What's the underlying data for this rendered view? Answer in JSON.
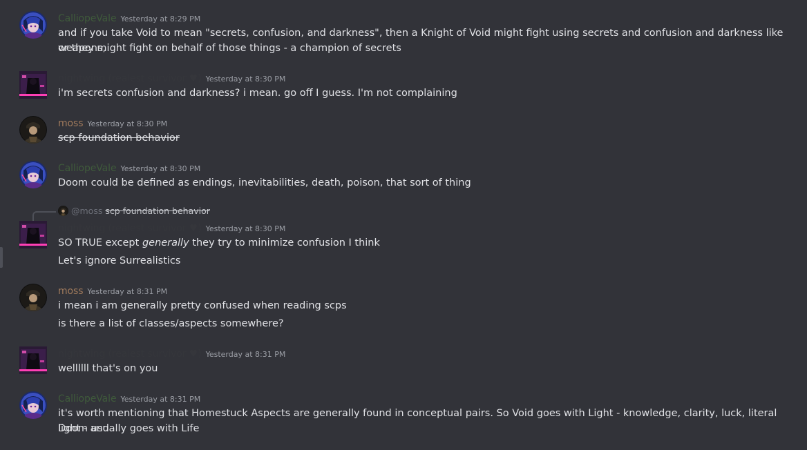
{
  "messages": [
    {
      "author": "CalliopeVale",
      "author_color": "#3f5a3b",
      "avatar": "calliope-avatar",
      "time": "Yesterday at 8:29 PM",
      "lines": [
        "and if you take Void to mean \"secrets, confusion, and darkness\", then a Knight of Void might fight using secrets and confusion and darkness like weapons,",
        "or they might fight on behalf of those things - a champion of secrets"
      ]
    },
    {
      "author": "nightwing (realest survivor ♥)",
      "author_color": "#35363b",
      "avatar": "nightwing-avatar",
      "time": "Yesterday at 8:30 PM",
      "lines": [
        "i'm secrets confusion and darkness? i mean. go off I guess. I'm not complaining"
      ]
    },
    {
      "author": "moss",
      "author_color": "#a07a5c",
      "avatar": "moss-avatar",
      "time": "Yesterday at 8:30 PM",
      "lines": [
        "scp foundation behavior"
      ]
    },
    {
      "author": "CalliopeVale",
      "author_color": "#3f5a3b",
      "avatar": "calliope-avatar",
      "time": "Yesterday at 8:30 PM",
      "lines": [
        "Doom could be defined as endings, inevitabilities, death, poison, that sort of thing"
      ]
    },
    {
      "reply": {
        "mention": "@moss",
        "text": "scp foundation behavior"
      },
      "author": "nightwing (realest survivor ♥)",
      "author_color": "#35363b",
      "avatar": "nightwing-avatar",
      "time": "Yesterday at 8:30 PM",
      "line1_pre": "SO TRUE except ",
      "line1_em": "generally",
      "line1_post": " they try to minimize confusion I think",
      "line2": "Let's ignore Surrealistics"
    },
    {
      "author": "moss",
      "author_color": "#a07a5c",
      "avatar": "moss-avatar",
      "time": "Yesterday at 8:31 PM",
      "lines": [
        "i mean i am generally pretty confused when reading scps",
        "is there a list of classes/aspects somewhere?"
      ]
    },
    {
      "author": "nightwing (realest survivor ♥)",
      "author_color": "#35363b",
      "avatar": "nightwing-avatar",
      "time": "Yesterday at 8:31 PM",
      "lines": [
        "wellllll that's on you"
      ]
    },
    {
      "author": "CalliopeVale",
      "author_color": "#3f5a3b",
      "avatar": "calliope-avatar",
      "time": "Yesterday at 8:31 PM",
      "lines": [
        "it's worth mentioning that Homestuck Aspects are generally found in conceptual pairs. So Void goes with Light - knowledge, clarity, luck, literal light - and",
        "Doom usually goes with Life"
      ]
    }
  ],
  "colors": {
    "background": "#323339",
    "text": "#e0e1e5",
    "timestamp": "#9c9fa6"
  }
}
